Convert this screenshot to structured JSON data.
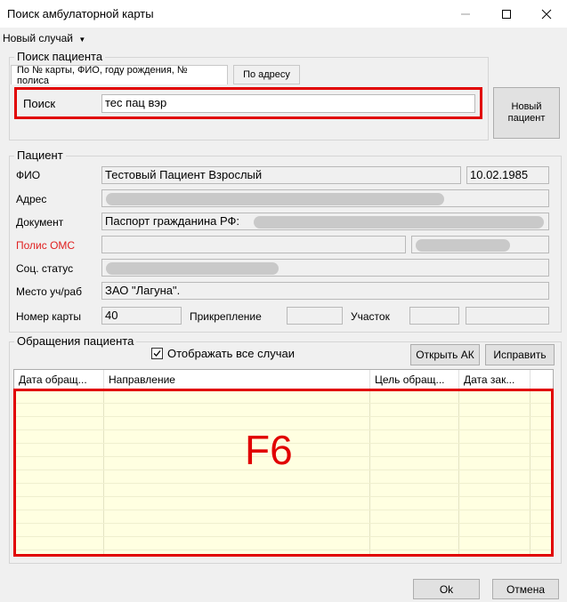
{
  "window": {
    "title": "Поиск амбулаторной карты"
  },
  "menu": {
    "new_case": "Новый случай"
  },
  "search": {
    "group_title": "Поиск пациента",
    "tabs": [
      "По № карты, ФИО, году рождения, № полиса",
      "По адресу"
    ],
    "label": "Поиск",
    "value": "тес пац вэр",
    "new_patient_button": "Новый пациент"
  },
  "patient": {
    "group_title": "Пациент",
    "fio_label": "ФИО",
    "fio": "Тестовый Пациент Взрослый",
    "birth_date": "10.02.1985",
    "address_label": "Адрес",
    "document_label": "Документ",
    "document": "Паспорт гражданина РФ:",
    "oms_label": "Полис ОМС",
    "social_label": "Соц. статус",
    "workplace_label": "Место уч/раб",
    "workplace": "ЗАО \"Лагуна\".",
    "card_number_label": "Номер карты",
    "card_number": "40",
    "attachment_label": "Прикрепление",
    "site_label": "Участок"
  },
  "appeals": {
    "group_title": "Обращения пациента",
    "show_all_label": "Отображать все случаи",
    "show_all_checked": true,
    "open_ak_button": "Открыть АК",
    "fix_button": "Исправить",
    "columns": [
      "Дата обращ...",
      "Направление",
      "Цель обращ...",
      "Дата зак..."
    ],
    "hotkey_label": "F6"
  },
  "footer": {
    "ok_button": "Ok",
    "cancel_button": "Отмена"
  },
  "colors": {
    "highlight": "#e10000",
    "grid_bg": "#ffffe1",
    "required_label": "#e02020"
  },
  "icons": {
    "minimize": "minimize-icon",
    "maximize": "maximize-icon",
    "close": "close-icon",
    "dropdown": "chevron-down-icon",
    "checkbox": "check-icon"
  }
}
